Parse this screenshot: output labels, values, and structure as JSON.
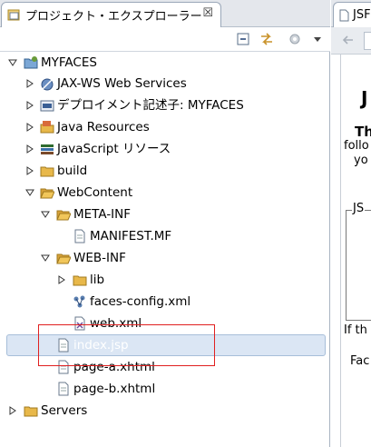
{
  "explorer": {
    "title": "プロジェクト・エクスプローラー",
    "close_glyph": "☒"
  },
  "tree": [
    {
      "label": "MYFACES",
      "expanded": true,
      "depth": 0,
      "icon": "project-icon"
    },
    {
      "label": "JAX-WS Web Services",
      "expanded": false,
      "depth": 1,
      "icon": "jaxws-icon"
    },
    {
      "label": "デプロイメント記述子: MYFACES",
      "expanded": false,
      "depth": 1,
      "icon": "deployment-descriptor-icon"
    },
    {
      "label": "Java Resources",
      "expanded": false,
      "depth": 1,
      "icon": "java-resources-icon"
    },
    {
      "label": "JavaScript リソース",
      "expanded": false,
      "depth": 1,
      "icon": "javascript-resources-icon"
    },
    {
      "label": "build",
      "expanded": false,
      "depth": 1,
      "icon": "folder-icon"
    },
    {
      "label": "WebContent",
      "expanded": true,
      "depth": 1,
      "icon": "folder-open-icon"
    },
    {
      "label": "META-INF",
      "expanded": true,
      "depth": 2,
      "icon": "folder-open-icon"
    },
    {
      "label": "MANIFEST.MF",
      "depth": 3,
      "icon": "file-icon"
    },
    {
      "label": "WEB-INF",
      "expanded": true,
      "depth": 2,
      "icon": "folder-open-icon"
    },
    {
      "label": "lib",
      "expanded": false,
      "depth": 3,
      "icon": "folder-icon"
    },
    {
      "label": "faces-config.xml",
      "depth": 3,
      "icon": "faces-config-icon"
    },
    {
      "label": "web.xml",
      "depth": 3,
      "icon": "xml-file-icon"
    },
    {
      "label": "index.jsp",
      "depth": 2,
      "icon": "jsp-file-icon",
      "selected": true
    },
    {
      "label": "page-a.xhtml",
      "depth": 2,
      "icon": "file-icon"
    },
    {
      "label": "page-b.xhtml",
      "depth": 2,
      "icon": "file-icon"
    },
    {
      "label": "Servers",
      "expanded": false,
      "depth": 0,
      "icon": "folder-icon"
    }
  ],
  "editor": {
    "tab_title": "JSF",
    "content": {
      "title_fragment": "J",
      "bold_fragment": "Th",
      "line1": "follo",
      "line2": "yo",
      "legend": "JS",
      "para1": "If th",
      "para2": "Fac"
    }
  },
  "colors": {
    "selection": "#dbe6f4",
    "annotation": "#e02020",
    "folder": "#e8b84a"
  }
}
